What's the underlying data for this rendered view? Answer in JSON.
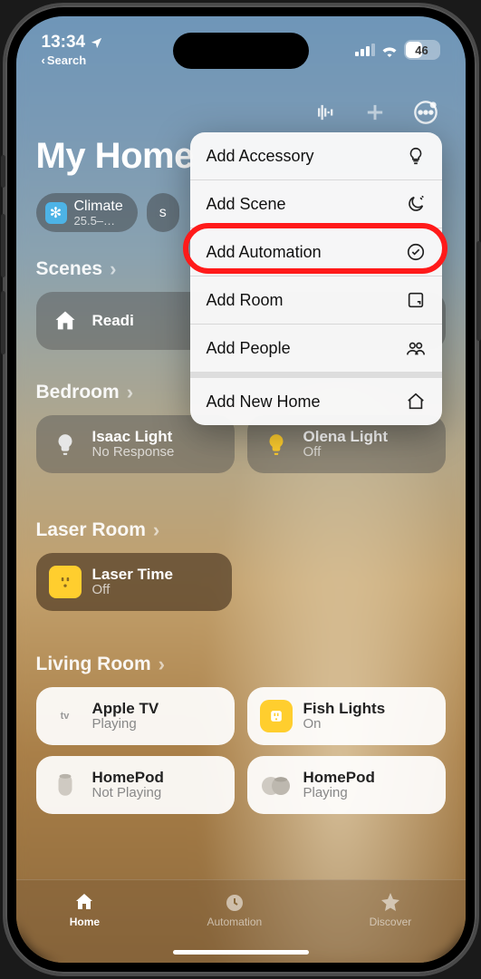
{
  "status": {
    "time": "13:34",
    "back_label": "Search",
    "battery_pct": "46"
  },
  "page": {
    "title": "My Home"
  },
  "chips": {
    "climate": {
      "label": "Climate",
      "sub": "25.5–…"
    },
    "other": {
      "label": "s"
    }
  },
  "menu": {
    "items": [
      {
        "label": "Add Accessory",
        "icon": "bulb"
      },
      {
        "label": "Add Scene",
        "icon": "moon"
      },
      {
        "label": "Add Automation",
        "icon": "clock"
      },
      {
        "label": "Add Room",
        "icon": "room"
      },
      {
        "label": "Add People",
        "icon": "people"
      },
      {
        "label": "Add New Home",
        "icon": "home"
      }
    ]
  },
  "sections": {
    "scenes": {
      "title": "Scenes",
      "tiles": [
        {
          "title": "Readi",
          "sub": "",
          "icon": "house"
        }
      ]
    },
    "bedroom": {
      "title": "Bedroom",
      "tiles": [
        {
          "title": "Isaac Light",
          "sub": "No Response",
          "icon": "bulb-off"
        },
        {
          "title": "Olena Light",
          "sub": "Off",
          "icon": "bulb-on"
        }
      ]
    },
    "laser": {
      "title": "Laser Room",
      "tiles": [
        {
          "title": "Laser Time",
          "sub": "Off",
          "icon": "outlet-y"
        }
      ]
    },
    "living": {
      "title": "Living Room",
      "tiles": [
        {
          "title": "Apple TV",
          "sub": "Playing",
          "icon": "appletv"
        },
        {
          "title": "Fish Lights",
          "sub": "On",
          "icon": "outlet-w"
        },
        {
          "title": "HomePod",
          "sub": "Not Playing",
          "icon": "homepod"
        },
        {
          "title": "HomePod",
          "sub": "Playing",
          "icon": "homepod2"
        }
      ]
    }
  },
  "tabs": {
    "home": "Home",
    "automation": "Automation",
    "discover": "Discover"
  }
}
